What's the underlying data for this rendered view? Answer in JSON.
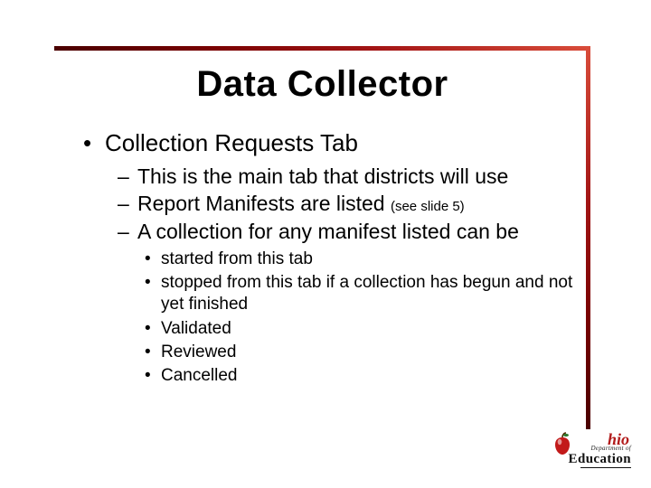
{
  "slide": {
    "title": "Data Collector",
    "bullets_lvl1": [
      "Collection Requests Tab"
    ],
    "bullets_lvl2": [
      {
        "text": "This is the main tab that districts will use"
      },
      {
        "text": "Report Manifests are listed",
        "note": "(see slide 5)"
      },
      {
        "text": "A collection for any manifest listed can be"
      }
    ],
    "bullets_lvl3": [
      "started from this tab",
      "stopped from this tab if a collection has begun and not yet finished",
      "Validated",
      "Reviewed",
      "Cancelled"
    ]
  },
  "logo": {
    "ohio_suffix": "hio",
    "dept": "Department of",
    "education": "Education"
  }
}
